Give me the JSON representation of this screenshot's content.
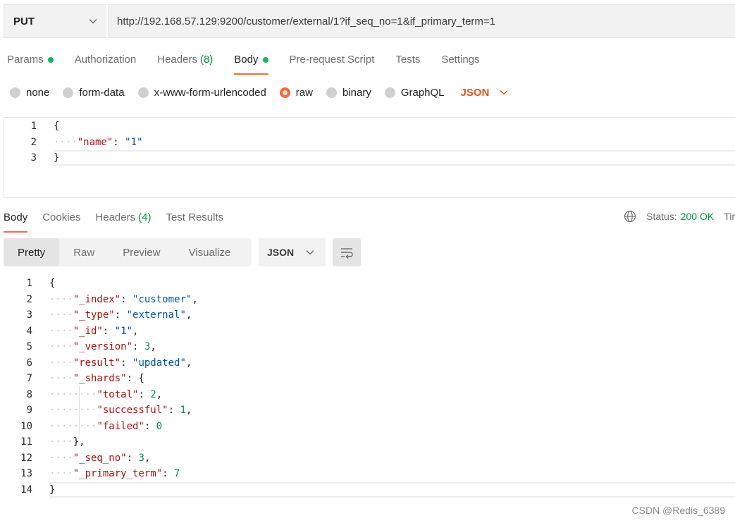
{
  "request": {
    "method": "PUT",
    "url": "http://192.168.57.129:9200/customer/external/1?if_seq_no=1&if_primary_term=1"
  },
  "request_tabs": [
    {
      "label": "Params",
      "dot": true,
      "active": false
    },
    {
      "label": "Authorization",
      "active": false
    },
    {
      "label": "Headers",
      "count": "(8)",
      "active": false
    },
    {
      "label": "Body",
      "dot": true,
      "active": true
    },
    {
      "label": "Pre-request Script",
      "active": false
    },
    {
      "label": "Tests",
      "active": false
    },
    {
      "label": "Settings",
      "active": false
    }
  ],
  "body_types": [
    {
      "label": "none",
      "selected": false
    },
    {
      "label": "form-data",
      "selected": false
    },
    {
      "label": "x-www-form-urlencoded",
      "selected": false
    },
    {
      "label": "raw",
      "selected": true
    },
    {
      "label": "binary",
      "selected": false
    },
    {
      "label": "GraphQL",
      "selected": false
    }
  ],
  "body_language": "JSON",
  "request_body": [
    {
      "n": "1",
      "tokens": [
        [
          "pun",
          "{"
        ]
      ]
    },
    {
      "n": "2",
      "tokens": [
        [
          "dots",
          "····"
        ],
        [
          "key",
          "\"name\""
        ],
        [
          "pun",
          ": "
        ],
        [
          "str",
          "\"1\""
        ]
      ]
    },
    {
      "n": "3",
      "tokens": [
        [
          "pun",
          "}"
        ]
      ]
    }
  ],
  "response_tabs": [
    {
      "label": "Body",
      "active": true
    },
    {
      "label": "Cookies",
      "active": false
    },
    {
      "label": "Headers",
      "count": "(4)",
      "active": false
    },
    {
      "label": "Test Results",
      "active": false
    }
  ],
  "status": {
    "label": "Status:",
    "value": "200 OK",
    "time_label": "Tir"
  },
  "view_modes": [
    {
      "label": "Pretty",
      "active": true
    },
    {
      "label": "Raw",
      "active": false
    },
    {
      "label": "Preview",
      "active": false
    },
    {
      "label": "Visualize",
      "active": false
    }
  ],
  "response_format": "JSON",
  "response_body": [
    {
      "n": "1",
      "tokens": [
        [
          "pun",
          "{"
        ]
      ]
    },
    {
      "n": "2",
      "tokens": [
        [
          "dots",
          "····"
        ],
        [
          "key",
          "\"_index\""
        ],
        [
          "pun",
          ": "
        ],
        [
          "str",
          "\"customer\""
        ],
        [
          "pun",
          ","
        ]
      ]
    },
    {
      "n": "3",
      "tokens": [
        [
          "dots",
          "····"
        ],
        [
          "key",
          "\"_type\""
        ],
        [
          "pun",
          ": "
        ],
        [
          "str",
          "\"external\""
        ],
        [
          "pun",
          ","
        ]
      ]
    },
    {
      "n": "4",
      "tokens": [
        [
          "dots",
          "····"
        ],
        [
          "key",
          "\"_id\""
        ],
        [
          "pun",
          ": "
        ],
        [
          "str",
          "\"1\""
        ],
        [
          "pun",
          ","
        ]
      ]
    },
    {
      "n": "5",
      "tokens": [
        [
          "dots",
          "····"
        ],
        [
          "key",
          "\"_version\""
        ],
        [
          "pun",
          ": "
        ],
        [
          "num",
          "3"
        ],
        [
          "pun",
          ","
        ]
      ]
    },
    {
      "n": "6",
      "tokens": [
        [
          "dots",
          "····"
        ],
        [
          "key",
          "\"result\""
        ],
        [
          "pun",
          ": "
        ],
        [
          "str",
          "\"updated\""
        ],
        [
          "pun",
          ","
        ]
      ]
    },
    {
      "n": "7",
      "tokens": [
        [
          "dots",
          "····"
        ],
        [
          "key",
          "\"_shards\""
        ],
        [
          "pun",
          ": {"
        ]
      ]
    },
    {
      "n": "8",
      "tokens": [
        [
          "dots",
          "········"
        ],
        [
          "key",
          "\"total\""
        ],
        [
          "pun",
          ": "
        ],
        [
          "num",
          "2"
        ],
        [
          "pun",
          ","
        ]
      ]
    },
    {
      "n": "9",
      "tokens": [
        [
          "dots",
          "········"
        ],
        [
          "key",
          "\"successful\""
        ],
        [
          "pun",
          ": "
        ],
        [
          "num",
          "1"
        ],
        [
          "pun",
          ","
        ]
      ]
    },
    {
      "n": "10",
      "tokens": [
        [
          "dots",
          "········"
        ],
        [
          "key",
          "\"failed\""
        ],
        [
          "pun",
          ": "
        ],
        [
          "num",
          "0"
        ]
      ]
    },
    {
      "n": "11",
      "tokens": [
        [
          "dots",
          "····"
        ],
        [
          "pun",
          "},"
        ]
      ]
    },
    {
      "n": "12",
      "tokens": [
        [
          "dots",
          "····"
        ],
        [
          "key",
          "\"_seq_no\""
        ],
        [
          "pun",
          ": "
        ],
        [
          "num",
          "3"
        ],
        [
          "pun",
          ","
        ]
      ]
    },
    {
      "n": "13",
      "tokens": [
        [
          "dots",
          "····"
        ],
        [
          "key",
          "\"_primary_term\""
        ],
        [
          "pun",
          ": "
        ],
        [
          "num",
          "7"
        ]
      ]
    },
    {
      "n": "14",
      "tokens": [
        [
          "pun",
          "}"
        ]
      ]
    }
  ],
  "watermark": "CSDN @Redis_6389",
  "icons": {
    "method_dropdown": "chevron-down-icon",
    "status": "globe-icon",
    "wrap": "wrap-lines-icon"
  },
  "colors": {
    "accent": "#f26b3a",
    "success": "#0cbb52",
    "string": "#0451a5",
    "key": "#a11313",
    "number": "#098658"
  }
}
